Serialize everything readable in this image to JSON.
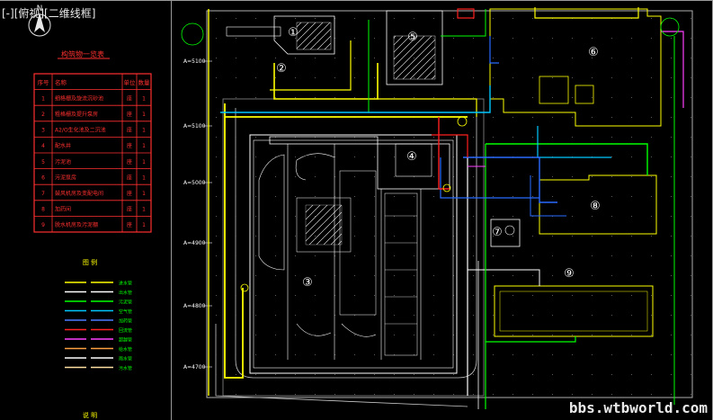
{
  "viewport": {
    "label": "[-][俯视][二维线框]"
  },
  "compass": {
    "symbol": "N"
  },
  "structure_table": {
    "title": "构筑物一览表",
    "headers": [
      "序号",
      "名称",
      "单位",
      "数量"
    ],
    "rows": [
      [
        "1",
        "细格栅及旋流沉砂池",
        "座",
        "1"
      ],
      [
        "2",
        "粗格栅及提升泵房",
        "座",
        "1"
      ],
      [
        "3",
        "A2/O生化池及二沉池",
        "座",
        "1"
      ],
      [
        "4",
        "配水井",
        "座",
        "1"
      ],
      [
        "5",
        "污泥池",
        "座",
        "1"
      ],
      [
        "6",
        "污泥泵房",
        "座",
        "1"
      ],
      [
        "7",
        "鼓风机房及变配电间",
        "座",
        "1"
      ],
      [
        "8",
        "加药间",
        "座",
        "1"
      ],
      [
        "9",
        "脱水机房及污泥棚",
        "座",
        "1"
      ]
    ]
  },
  "legend": {
    "title": "图    例",
    "items": [
      {
        "color": "#ffff00",
        "label": "进水管"
      },
      {
        "color": "#ffffff",
        "label": "出水管"
      },
      {
        "color": "#00ff00",
        "label": "污泥管"
      },
      {
        "color": "#00c8ff",
        "label": "空气管"
      },
      {
        "color": "#4a7bff",
        "label": "加药管"
      },
      {
        "color": "#ff2020",
        "label": "回流管"
      },
      {
        "color": "#ff40ff",
        "label": "超越管"
      },
      {
        "color": "#ffa040",
        "label": "给水管"
      },
      {
        "color": "#ffffff",
        "label": "雨水管"
      },
      {
        "color": "#ffe0a0",
        "label": "污水管"
      }
    ],
    "footer": "说    明"
  },
  "axis_labels": [
    "A=5100",
    "A=5100",
    "A=5000",
    "A=4900",
    "A=4800",
    "A=4700"
  ],
  "plan_numbers": [
    "①",
    "②",
    "③",
    "④",
    "⑤",
    "⑥",
    "⑦",
    "⑧",
    "⑨"
  ],
  "watermark": "bbs.wtbworld.com",
  "colors": {
    "background": "#000000",
    "yellow": "#ffff00",
    "white": "#ffffff",
    "green": "#00ff00",
    "cyan": "#00c8ff",
    "blue": "#2a6bff",
    "red": "#ff2020",
    "magenta": "#ff40ff",
    "gray": "#8c8c8c"
  }
}
